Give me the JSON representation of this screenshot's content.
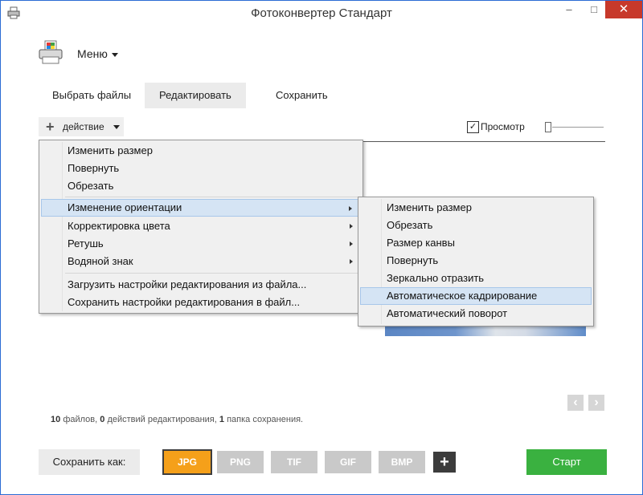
{
  "window": {
    "title": "Фотоконвертер Стандарт",
    "minimize": "–",
    "maximize": "□",
    "close": "✕"
  },
  "header": {
    "menu_label": "Меню"
  },
  "tabs": [
    {
      "label": "Выбрать файлы"
    },
    {
      "label": "Редактировать"
    },
    {
      "label": "Сохранить"
    }
  ],
  "toolbar": {
    "action_label": "действие",
    "preview_label": "Просмотр",
    "preview_checked": "✓"
  },
  "action_menu": {
    "items": [
      {
        "label": "Изменить размер"
      },
      {
        "label": "Повернуть"
      },
      {
        "label": "Обрезать"
      },
      {
        "label": "Изменение ориентации"
      },
      {
        "label": "Корректировка цвета"
      },
      {
        "label": "Ретушь"
      },
      {
        "label": "Водяной знак"
      },
      {
        "label": "Загрузить настройки редактирования из файла..."
      },
      {
        "label": "Сохранить настройки редактирования в файл..."
      }
    ]
  },
  "orientation_submenu": {
    "items": [
      {
        "label": "Изменить размер"
      },
      {
        "label": "Обрезать"
      },
      {
        "label": "Размер канвы"
      },
      {
        "label": "Повернуть"
      },
      {
        "label": "Зеркально отразить"
      },
      {
        "label": "Автоматическое кадрирование"
      },
      {
        "label": "Автоматический поворот"
      }
    ]
  },
  "status": {
    "files_count": "10",
    "files_text": "файлов,",
    "actions_count": "0",
    "actions_text": "действий редактирования,",
    "folders_count": "1",
    "folders_text": "папка сохранения."
  },
  "nav": {
    "prev": "‹",
    "next": "›"
  },
  "bottom": {
    "save_as_label": "Сохранить как:",
    "formats": [
      "JPG",
      "PNG",
      "TIF",
      "GIF",
      "BMP"
    ],
    "add_format": "+",
    "start_label": "Старт"
  },
  "colors": {
    "accent": "#f5a01a",
    "start": "#3ab140",
    "highlight": "#d5e4f4"
  },
  "icons": {
    "app": "printer-photo-icon",
    "logo": "printer-photo-icon",
    "add": "plus-icon"
  }
}
